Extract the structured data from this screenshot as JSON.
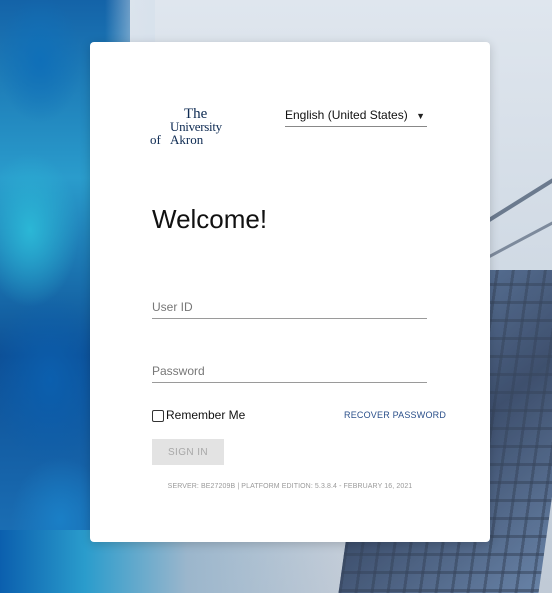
{
  "brand": {
    "logo_line1": "The",
    "logo_line2": "University",
    "logo_line3": "of",
    "logo_line4": "Akron"
  },
  "language": {
    "selected": "English (United States)",
    "caret_icon": "caret-down-icon"
  },
  "login": {
    "heading": "Welcome!",
    "user_id_placeholder": "User ID",
    "password_placeholder": "Password",
    "remember_label": "Remember Me",
    "remember_checked": false,
    "recover_label": "RECOVER PASSWORD",
    "signin_label": "SIGN IN"
  },
  "footer": {
    "server_info": "SERVER: BE27209B | PLATFORM EDITION: 5.3.8.4 - FEBRUARY 16, 2021"
  },
  "colors": {
    "card_bg": "#ffffff",
    "link": "#2a4f8a",
    "logo": "#0d2a52",
    "button_disabled_bg": "#e3e3e3",
    "button_disabled_text": "#a8a8a8"
  }
}
